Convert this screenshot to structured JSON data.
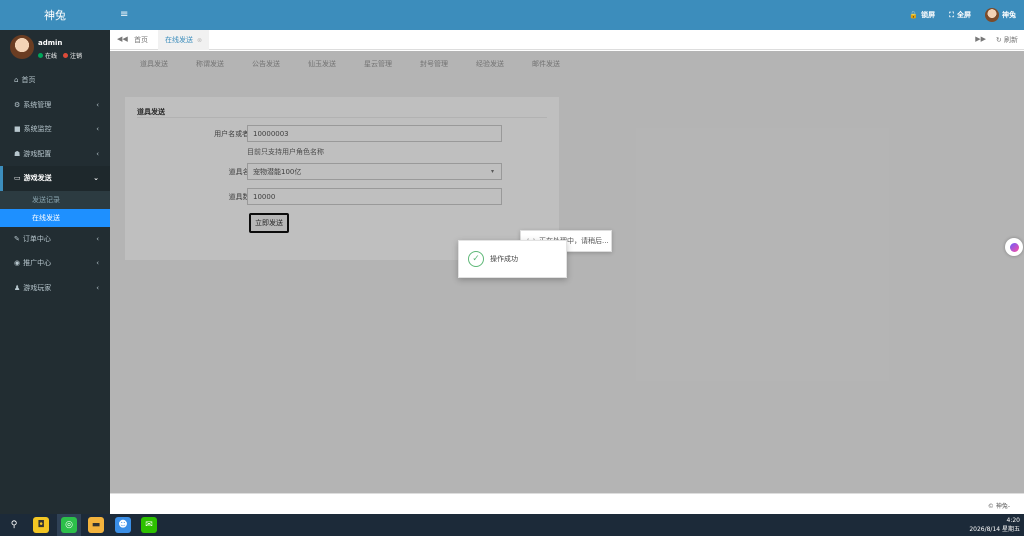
{
  "app": {
    "logo": "神兔"
  },
  "header": {
    "menu_icon": "hamburger-icon",
    "lock_label": "锁屏",
    "fullscreen_label": "全屏",
    "user_label": "神兔"
  },
  "user": {
    "name": "admin",
    "status_online": "在线",
    "logout": "注销"
  },
  "sidebar": {
    "items": [
      {
        "label": "首页",
        "icon": "home-icon"
      },
      {
        "label": "系统管理",
        "icon": "gear-icon"
      },
      {
        "label": "系统监控",
        "icon": "video-icon"
      },
      {
        "label": "游戏配置",
        "icon": "gamepad-icon"
      },
      {
        "label": "游戏发送",
        "icon": "keyboard-icon"
      },
      {
        "label": "订单中心",
        "icon": "pencil-icon"
      },
      {
        "label": "推广中心",
        "icon": "eye-icon"
      },
      {
        "label": "游戏玩家",
        "icon": "user-icon"
      }
    ],
    "submenu": [
      "发送记录",
      "在线发送"
    ]
  },
  "tabs": {
    "home": "首页",
    "current": "在线发送",
    "refresh": "刷新"
  },
  "subnav": [
    "道具发送",
    "称谓发送",
    "公告发送",
    "仙玉发送",
    "星云管理",
    "封号管理",
    "经验发送",
    "邮件发送"
  ],
  "panel": {
    "title": "道具发送",
    "user_label": "用户名或者ID:",
    "user_value": "10000003",
    "user_help": "目前只支持用户角色名称",
    "item_label": "道具名称:",
    "item_value": "宠物潜能100亿",
    "qty_label": "道具数量:",
    "qty_value": "10000",
    "submit": "立即发送"
  },
  "loading_text": "正在处理中，请稍后...",
  "toast_text": "操作成功",
  "footer": "© 神兔-",
  "taskbar": {
    "time": "4:20",
    "date": "2026/8/14 星期五"
  },
  "colors": {
    "brand": "#3c8dbc",
    "sidebar": "#222d32",
    "active": "#1e90ff",
    "success": "#5fb878"
  }
}
